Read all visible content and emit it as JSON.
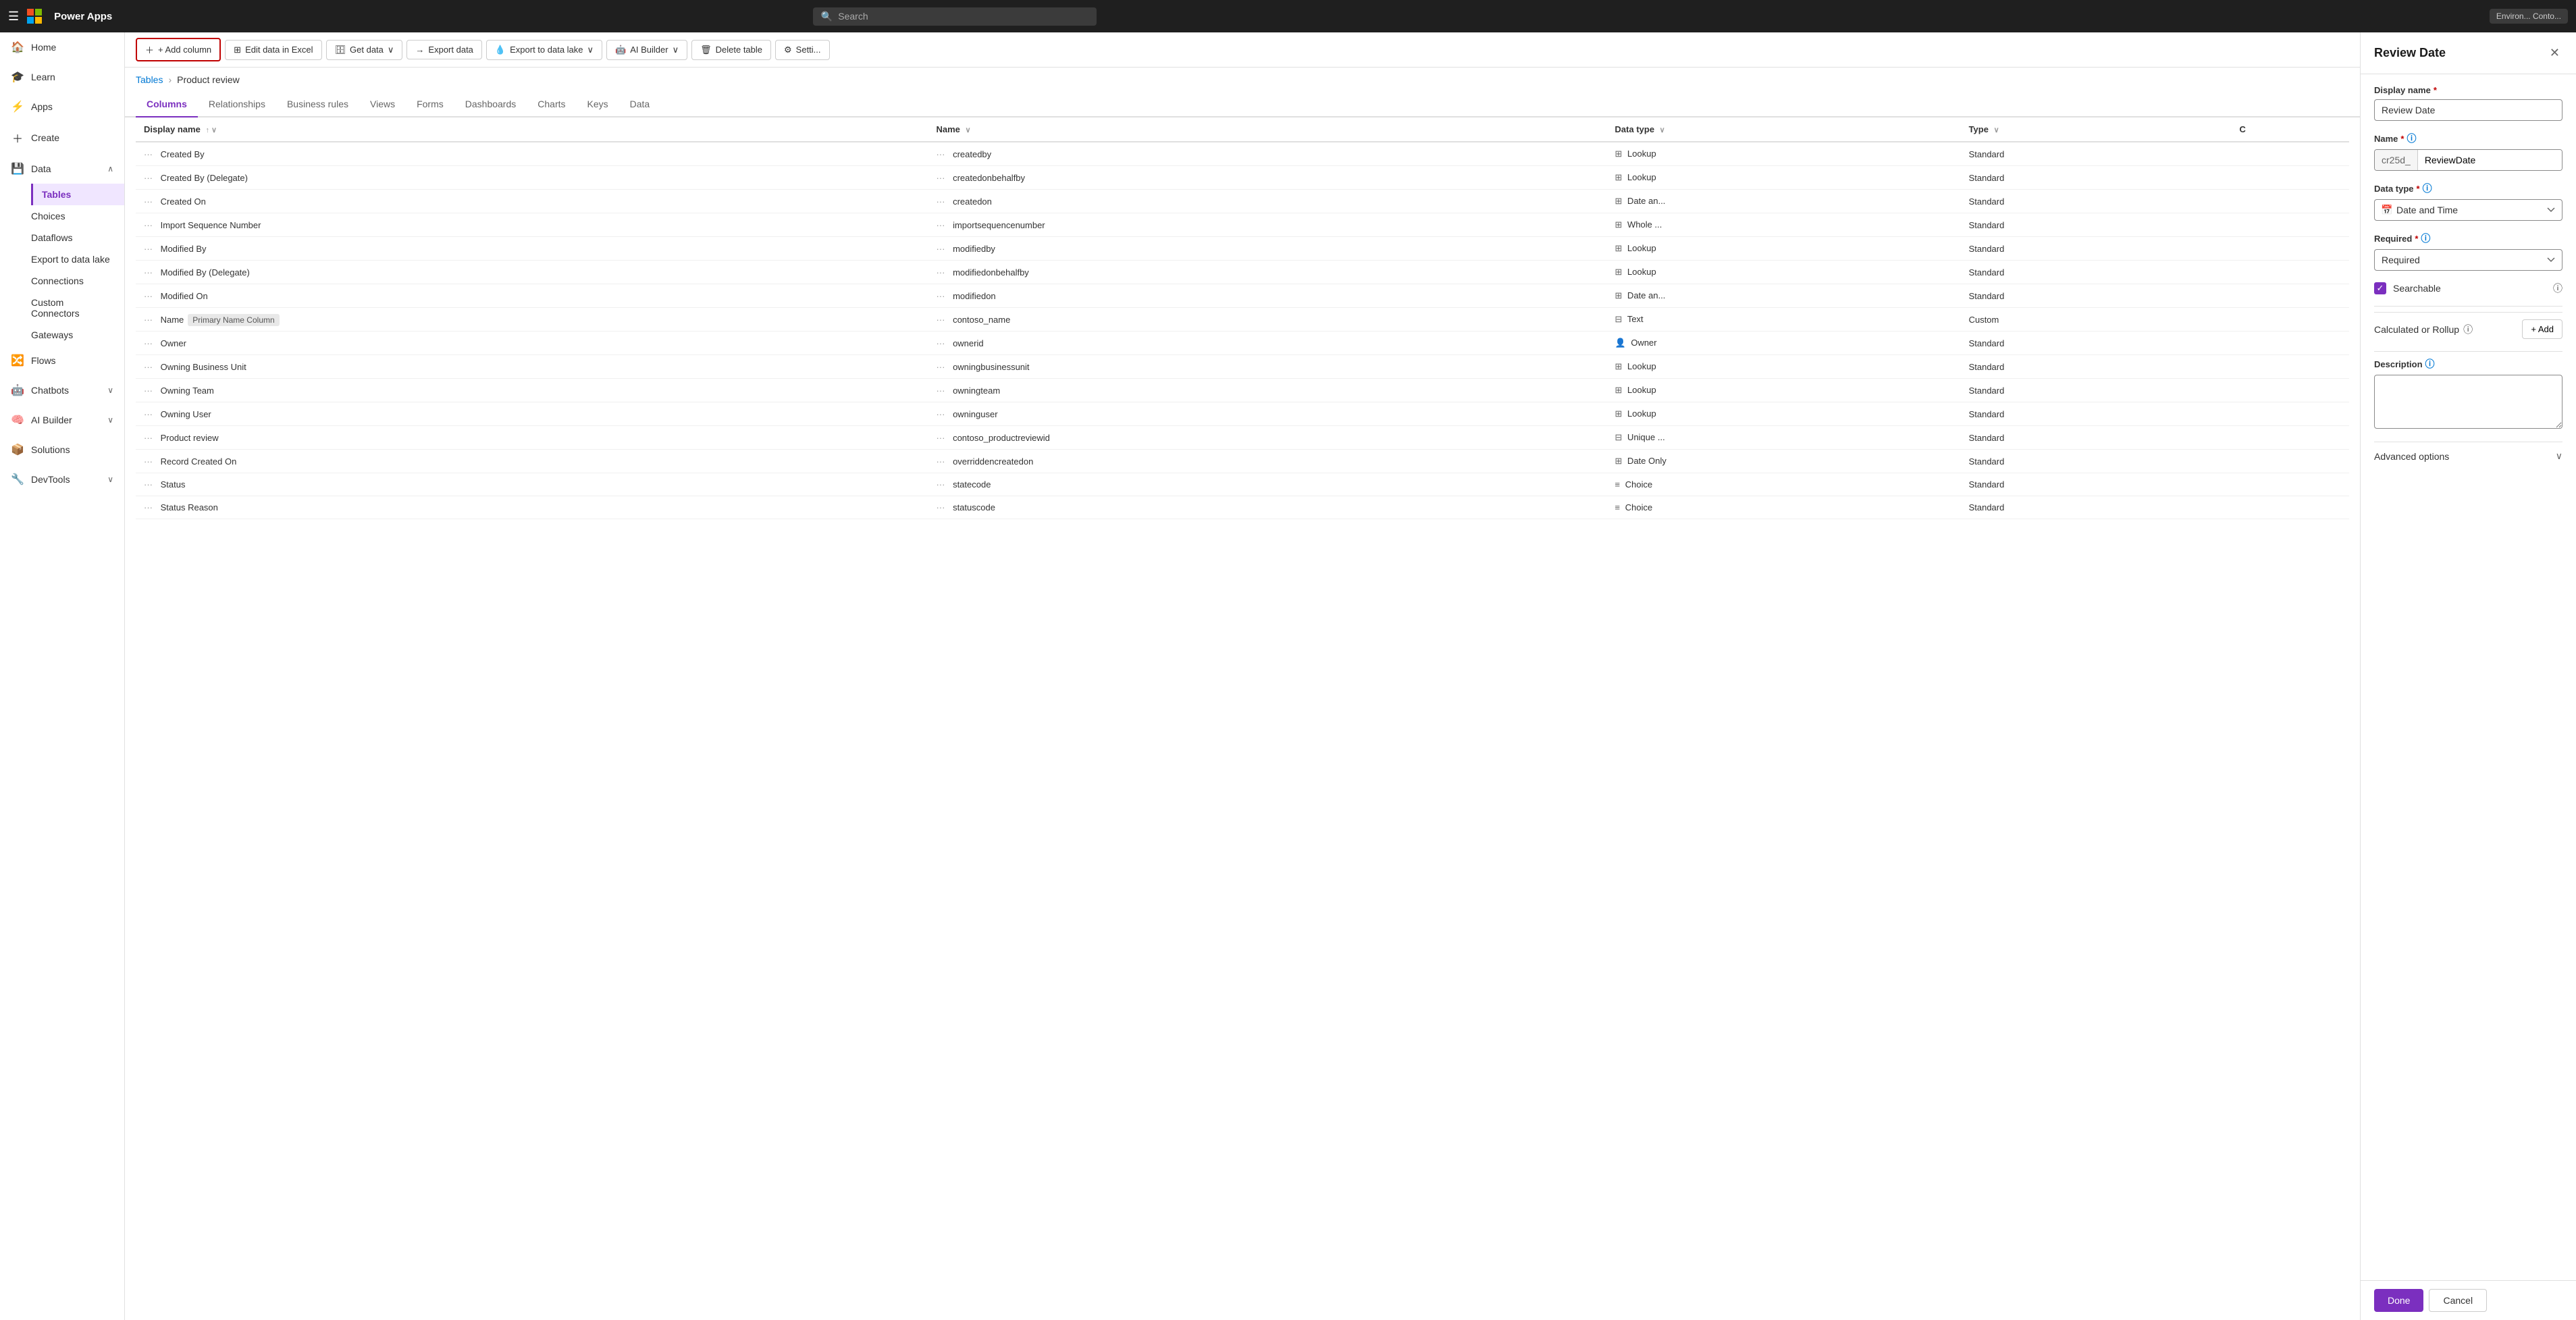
{
  "topNav": {
    "appName": "Power Apps",
    "searchPlaceholder": "Search",
    "envLabel": "Environ... Conto..."
  },
  "sidebar": {
    "items": [
      {
        "id": "home",
        "label": "Home",
        "icon": "🏠",
        "active": false
      },
      {
        "id": "learn",
        "label": "Learn",
        "icon": "🎓",
        "active": false
      },
      {
        "id": "apps",
        "label": "Apps",
        "icon": "⚡",
        "active": false
      },
      {
        "id": "create",
        "label": "Create",
        "icon": "＋",
        "active": false
      },
      {
        "id": "data",
        "label": "Data",
        "icon": "💾",
        "active": false,
        "expanded": true
      },
      {
        "id": "tables",
        "label": "Tables",
        "icon": "",
        "active": true
      },
      {
        "id": "choices",
        "label": "Choices",
        "icon": "",
        "active": false
      },
      {
        "id": "dataflows",
        "label": "Dataflows",
        "icon": "",
        "active": false
      },
      {
        "id": "export-to-data-lake",
        "label": "Export to data lake",
        "icon": "",
        "active": false
      },
      {
        "id": "connections",
        "label": "Connections",
        "icon": "",
        "active": false
      },
      {
        "id": "custom-connectors",
        "label": "Custom Connectors",
        "icon": "",
        "active": false
      },
      {
        "id": "gateways",
        "label": "Gateways",
        "icon": "",
        "active": false
      },
      {
        "id": "flows",
        "label": "Flows",
        "icon": "🔀",
        "active": false
      },
      {
        "id": "chatbots",
        "label": "Chatbots",
        "icon": "🤖",
        "active": false,
        "hasChevron": true
      },
      {
        "id": "ai-builder",
        "label": "AI Builder",
        "icon": "🧠",
        "active": false,
        "hasChevron": true
      },
      {
        "id": "solutions",
        "label": "Solutions",
        "icon": "📦",
        "active": false
      },
      {
        "id": "devtools",
        "label": "DevTools",
        "icon": "🔧",
        "active": false,
        "hasChevron": true
      }
    ]
  },
  "toolbar": {
    "addColumnLabel": "+ Add column",
    "editDataLabel": "Edit data in Excel",
    "getDataLabel": "Get data",
    "exportDataLabel": "Export data",
    "exportToDataLakeLabel": "Export to data lake",
    "aiBuilderLabel": "AI Builder",
    "deleteTableLabel": "Delete table",
    "settingsLabel": "Setti..."
  },
  "breadcrumb": {
    "parent": "Tables",
    "current": "Product review"
  },
  "tabs": [
    {
      "id": "columns",
      "label": "Columns",
      "active": true
    },
    {
      "id": "relationships",
      "label": "Relationships",
      "active": false
    },
    {
      "id": "business-rules",
      "label": "Business rules",
      "active": false
    },
    {
      "id": "views",
      "label": "Views",
      "active": false
    },
    {
      "id": "forms",
      "label": "Forms",
      "active": false
    },
    {
      "id": "dashboards",
      "label": "Dashboards",
      "active": false
    },
    {
      "id": "charts",
      "label": "Charts",
      "active": false
    },
    {
      "id": "keys",
      "label": "Keys",
      "active": false
    },
    {
      "id": "data",
      "label": "Data",
      "active": false
    }
  ],
  "table": {
    "headers": [
      "Display name",
      "Name",
      "Data type",
      "Type",
      "C"
    ],
    "rows": [
      {
        "displayName": "Created By",
        "name": "createdby",
        "dataType": "Lookup",
        "dataTypeIcon": "⊞",
        "type": "Standard",
        "badge": ""
      },
      {
        "displayName": "Created By (Delegate)",
        "name": "createdonbehalfby",
        "dataType": "Lookup",
        "dataTypeIcon": "⊞",
        "type": "Standard",
        "badge": ""
      },
      {
        "displayName": "Created On",
        "name": "createdon",
        "dataType": "Date an...",
        "dataTypeIcon": "⊞",
        "type": "Standard",
        "badge": ""
      },
      {
        "displayName": "Import Sequence Number",
        "name": "importsequencenumber",
        "dataType": "Whole ...",
        "dataTypeIcon": "⊞",
        "type": "Standard",
        "badge": ""
      },
      {
        "displayName": "Modified By",
        "name": "modifiedby",
        "dataType": "Lookup",
        "dataTypeIcon": "⊞",
        "type": "Standard",
        "badge": ""
      },
      {
        "displayName": "Modified By (Delegate)",
        "name": "modifiedonbehalfby",
        "dataType": "Lookup",
        "dataTypeIcon": "⊞",
        "type": "Standard",
        "badge": ""
      },
      {
        "displayName": "Modified On",
        "name": "modifiedon",
        "dataType": "Date an...",
        "dataTypeIcon": "⊞",
        "type": "Standard",
        "badge": ""
      },
      {
        "displayName": "Name",
        "name": "contoso_name",
        "dataType": "Text",
        "dataTypeIcon": "⊟",
        "type": "Custom",
        "badge": "Primary Name Column"
      },
      {
        "displayName": "Owner",
        "name": "ownerid",
        "dataType": "Owner",
        "dataTypeIcon": "👤",
        "type": "Standard",
        "badge": ""
      },
      {
        "displayName": "Owning Business Unit",
        "name": "owningbusinessunit",
        "dataType": "Lookup",
        "dataTypeIcon": "⊞",
        "type": "Standard",
        "badge": ""
      },
      {
        "displayName": "Owning Team",
        "name": "owningteam",
        "dataType": "Lookup",
        "dataTypeIcon": "⊞",
        "type": "Standard",
        "badge": ""
      },
      {
        "displayName": "Owning User",
        "name": "owninguser",
        "dataType": "Lookup",
        "dataTypeIcon": "⊞",
        "type": "Standard",
        "badge": ""
      },
      {
        "displayName": "Product review",
        "name": "contoso_productreviewid",
        "dataType": "Unique ...",
        "dataTypeIcon": "⊟",
        "type": "Standard",
        "badge": ""
      },
      {
        "displayName": "Record Created On",
        "name": "overriddencreatedon",
        "dataType": "Date Only",
        "dataTypeIcon": "⊞",
        "type": "Standard",
        "badge": ""
      },
      {
        "displayName": "Status",
        "name": "statecode",
        "dataType": "Choice",
        "dataTypeIcon": "≡",
        "type": "Standard",
        "badge": ""
      },
      {
        "displayName": "Status Reason",
        "name": "statuscode",
        "dataType": "Choice",
        "dataTypeIcon": "≡",
        "type": "Standard",
        "badge": ""
      }
    ]
  },
  "panel": {
    "title": "Review Date",
    "closeIcon": "✕",
    "fields": {
      "displayNameLabel": "Display name",
      "displayNameRequired": "*",
      "displayNameValue": "Review Date",
      "nameLabel": "Name",
      "nameRequired": "*",
      "namePrefix": "cr25d_",
      "nameValue": "ReviewDate",
      "dataTypeLabel": "Data type",
      "dataTypeRequired": "*",
      "dataTypeIcon": "📅",
      "dataTypeValue": "Date and Time",
      "requiredLabel": "Required",
      "requiredRequired": "*",
      "requiredValue": "Required",
      "searchableLabel": "Searchable",
      "searchableChecked": true,
      "calculatedOrRollupLabel": "Calculated or Rollup",
      "addLabel": "+ Add",
      "descriptionLabel": "Description",
      "advancedOptionsLabel": "Advanced options"
    },
    "footer": {
      "doneLabel": "Done",
      "cancelLabel": "Cancel"
    }
  }
}
